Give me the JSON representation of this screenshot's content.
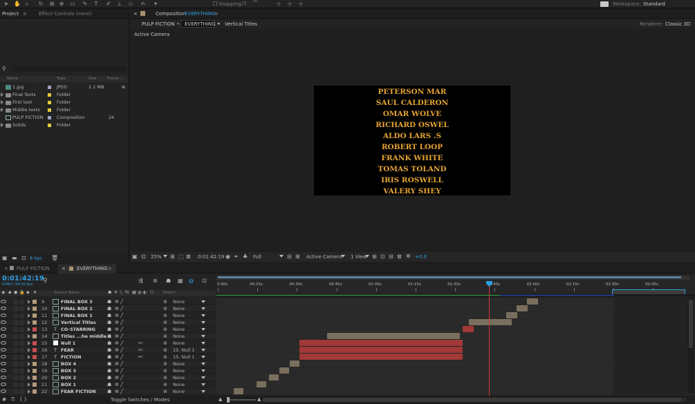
{
  "toolbar": {
    "snapping": "Snapping",
    "workspace_label": "Workspace:",
    "workspace_value": "Standard"
  },
  "project_panel": {
    "tab_project": "Project",
    "tab_effect_controls": "Effect Controls (none)",
    "columns": [
      "Name",
      "Type",
      "Size",
      "Frame ..."
    ],
    "items": [
      {
        "name": "1.jpg",
        "type": "JPEG",
        "size": "1.1 MB",
        "frame": "",
        "kind": "image",
        "label_color": "#9aa2c8"
      },
      {
        "name": "Final Texts",
        "type": "Folder",
        "size": "",
        "frame": "",
        "kind": "folder",
        "label_color": "#e5c93c"
      },
      {
        "name": "First text",
        "type": "Folder",
        "size": "",
        "frame": "",
        "kind": "folder",
        "label_color": "#e5c93c"
      },
      {
        "name": "Middle texts",
        "type": "Folder",
        "size": "",
        "frame": "",
        "kind": "folder",
        "label_color": "#e5c93c"
      },
      {
        "name": "PULP FICTION",
        "type": "Composition",
        "size": "",
        "frame": "24",
        "kind": "comp",
        "label_color": "#9aa2c8"
      },
      {
        "name": "Solids",
        "type": "Folder",
        "size": "",
        "frame": "",
        "kind": "folder",
        "label_color": "#e5c93c"
      }
    ],
    "bpc": "8 bpc"
  },
  "comp_panel": {
    "title_prefix": "Composition",
    "title_name": "EVERYTHING",
    "breadcrumbs": [
      "PULP FICTION",
      "EVERYTHING",
      "Vertical Titles"
    ],
    "renderer_label": "Renderer:",
    "renderer_value": "Classic 3D",
    "active_camera": "Active Camera",
    "credits": [
      "PETERSON MAR",
      "SAUL CALDERON",
      "OMAR WOLVE",
      "RICHARD OSWEL",
      "ALDO LARS .S",
      "ROBERT LOOP",
      "FRANK WHITE",
      "TOMAS TOLAND",
      "IRIS ROSWELL",
      "VALERY SHEY"
    ],
    "footer": {
      "zoom": "25%",
      "timecode": "0:01:42:19",
      "resolution": "Full",
      "camera": "Active Camera",
      "view": "1 View",
      "exposure": "+0.0"
    }
  },
  "timeline": {
    "tabs": [
      "PULP FICTION",
      "EVERYTHING"
    ],
    "timecode": "0:01:42:19",
    "frames": "02467 (24.00 fps)",
    "col_source": "Source Name",
    "col_parent": "Parent",
    "ruler": [
      "0:00s",
      "00:15s",
      "00:30s",
      "00:45s",
      "01:00s",
      "01:15s",
      "01:30s",
      "01:45s",
      "02:00s",
      "02:15s",
      "02:30s",
      "02:45s"
    ],
    "toggle_label": "Toggle Switches / Modes",
    "layers": [
      {
        "num": "9",
        "name": "FINAL BOX 3",
        "parent": "None",
        "label_color": "#b59b7c",
        "type": "comp"
      },
      {
        "num": "10",
        "name": "FINAL BOX 2",
        "parent": "None",
        "label_color": "#b59b7c",
        "type": "comp"
      },
      {
        "num": "11",
        "name": "FINAL BOX 1",
        "parent": "None",
        "label_color": "#b59b7c",
        "type": "comp"
      },
      {
        "num": "12",
        "name": "Vertical Titles",
        "parent": "None",
        "label_color": "#b59b7c",
        "type": "comp"
      },
      {
        "num": "13",
        "name": "CO-STARRING",
        "parent": "None",
        "label_color": "#c85050",
        "type": "text"
      },
      {
        "num": "14",
        "name": "Titles ...he middle",
        "parent": "None",
        "label_color": "#b59b7c",
        "type": "comp"
      },
      {
        "num": "15",
        "name": "Null 1",
        "parent": "None",
        "label_color": "#c85050",
        "type": "null"
      },
      {
        "num": "16",
        "name": "FEAR",
        "parent": "15. Null 1",
        "label_color": "#c85050",
        "type": "text"
      },
      {
        "num": "17",
        "name": "FICTION",
        "parent": "15. Null 1",
        "label_color": "#c85050",
        "type": "text"
      },
      {
        "num": "18",
        "name": "BOX 4",
        "parent": "None",
        "label_color": "#b59b7c",
        "type": "comp"
      },
      {
        "num": "19",
        "name": "BOX 3",
        "parent": "None",
        "label_color": "#b59b7c",
        "type": "comp"
      },
      {
        "num": "20",
        "name": "BOX 2",
        "parent": "None",
        "label_color": "#b59b7c",
        "type": "comp"
      },
      {
        "num": "21",
        "name": "BOX 1",
        "parent": "None",
        "label_color": "#b59b7c",
        "type": "comp"
      },
      {
        "num": "22",
        "name": "FEAR FICTION",
        "parent": "None",
        "label_color": "#b59b7c",
        "type": "comp"
      }
    ]
  },
  "colors": {
    "accent": "#2f9fe0",
    "credit_text": "#e3a233",
    "bar_tan": "#7a6e5e",
    "bar_red": "#a23838",
    "playhead": "#d23a3a"
  }
}
